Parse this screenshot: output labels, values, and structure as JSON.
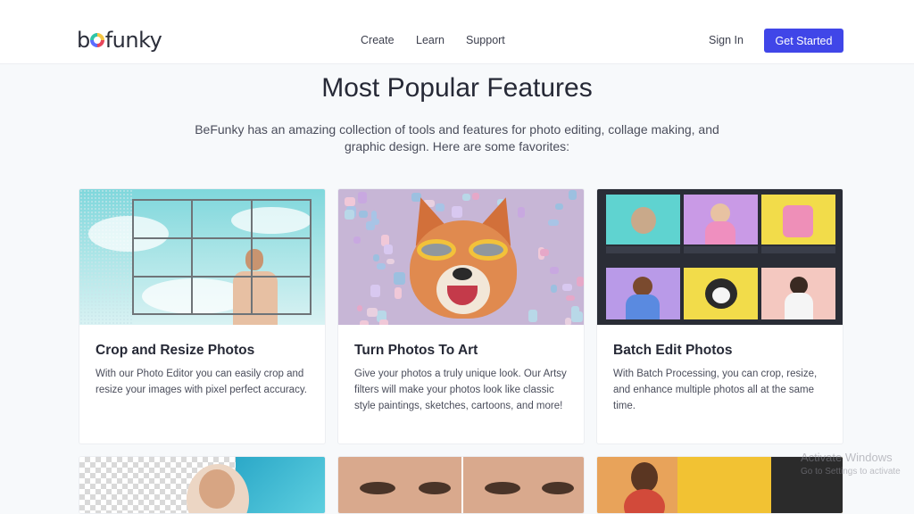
{
  "header": {
    "logo_text": "befunky",
    "nav": {
      "create": "Create",
      "learn": "Learn",
      "support": "Support"
    },
    "sign_in": "Sign In",
    "cta": "Get Started",
    "cta_color": "#4046e8"
  },
  "hero": {
    "title": "Most Popular Features",
    "subtitle": "BeFunky has an amazing collection of tools and features for photo editing, collage making, and graphic design. Here are some favorites:"
  },
  "cards": [
    {
      "title": "Crop and Resize Photos",
      "description": "With our Photo Editor you can easily crop and resize your images with pixel perfect accuracy."
    },
    {
      "title": "Turn Photos To Art",
      "description": "Give your photos a truly unique look. Our Artsy filters will make your photos look like classic style paintings, sketches, cartoons, and more!"
    },
    {
      "title": "Batch Edit Photos",
      "description": "With Batch Processing, you can crop, resize, and enhance multiple photos all at the same time."
    }
  ],
  "watermark": {
    "line1": "Activate Windows",
    "line2": "Go to Settings to activate"
  }
}
